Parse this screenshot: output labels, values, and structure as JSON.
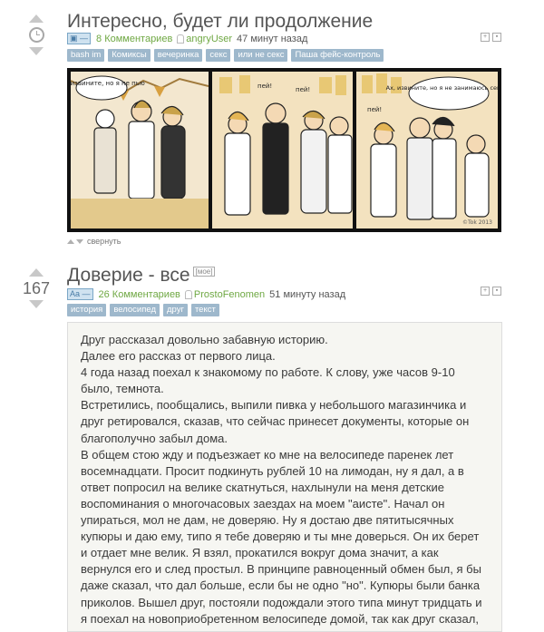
{
  "post1": {
    "title": "Интересно, будет ли продолжение",
    "comments": "8 Комментариев",
    "author": "angryUser",
    "time": "47 минут назад",
    "tags": [
      "bash im",
      "Комиксы",
      "вечеринка",
      "секс",
      "или не секс",
      "Паша фейс-контроль"
    ],
    "comic_bubbles": [
      "Ах, извините, но я не пью",
      "пей!",
      "пей!",
      "Ах, извините, но я не занимаюсь сексом",
      "пей!"
    ],
    "comic_signature": "©Tok 2013",
    "collapse_label": "свернуть"
  },
  "post2": {
    "rating": "167",
    "title": "Доверие - все",
    "my_tag": "[мое]",
    "comments": "26 Комментариев",
    "author": "ProstoFenomen",
    "time": "51 минуту назад",
    "tags": [
      "история",
      "велосипед",
      "друг",
      "текст"
    ],
    "paragraphs": [
      "Друг рассказал довольно забавную историю.",
      "Далее его рассказ от первого лица.",
      "4 года назад поехал к знакомому по работе. К слову, уже часов 9-10 было, темнота.",
      "Встретились, пообщались, выпили пивка у небольшого магазинчика и друг ретировался, сказав, что сейчас принесет документы, которые он благополучно забыл дома.",
      "В общем стою жду и подъезжает ко мне на велосипеде паренек лет восемнадцати. Просит подкинуть рублей 10 на лимодан, ну я дал, а в ответ попросил на велике скатнуться, нахлынули на меня детские воспоминания о многочасовых заездах на моем \"аисте\". Начал он упираться, мол не дам, не доверяю. Ну я достаю две пятитысячных купюры и даю ему, типо я тебе доверяю и ты мне доверься. Он их берет и отдает мне велик. Я взял, прокатился вокруг дома значит, а как вернулся его и след простыл. В принципе равноценный обмен был, я бы даже сказал, что дал больше, если бы не одно \"но\". Купюры были банка приколов. Вышел друг, постояли подождали этого типа минут тридцать и я поехал на новоприобретенном велосипеде домой, так как друг сказал,"
    ]
  },
  "icons": {
    "arrow_up": "arrow-up-icon",
    "arrow_down": "arrow-down-icon",
    "clock": "clock-icon",
    "user": "user-icon"
  },
  "colors": {
    "link_green": "#6fa843",
    "tag_bg": "#9eb8cc",
    "arrow_gray": "#c8c8c8"
  }
}
